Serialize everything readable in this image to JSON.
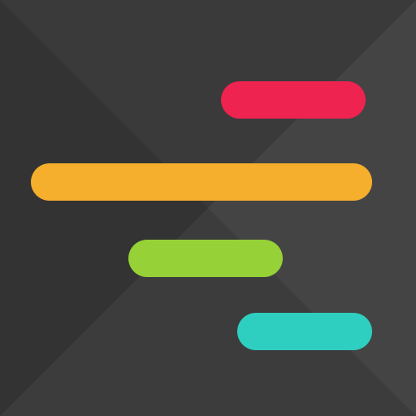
{
  "icon": {
    "name": "gantt-timeline-app-icon",
    "background": {
      "base": "#353535",
      "facets": [
        "#3a3a3a",
        "#444444",
        "#3c3c3c",
        "#333333"
      ]
    },
    "bars": [
      {
        "name": "timeline-bar-red",
        "color": "#ee2350"
      },
      {
        "name": "timeline-bar-orange",
        "color": "#f6ae2d"
      },
      {
        "name": "timeline-bar-green",
        "color": "#95d137"
      },
      {
        "name": "timeline-bar-teal",
        "color": "#2ecfc0"
      }
    ]
  }
}
